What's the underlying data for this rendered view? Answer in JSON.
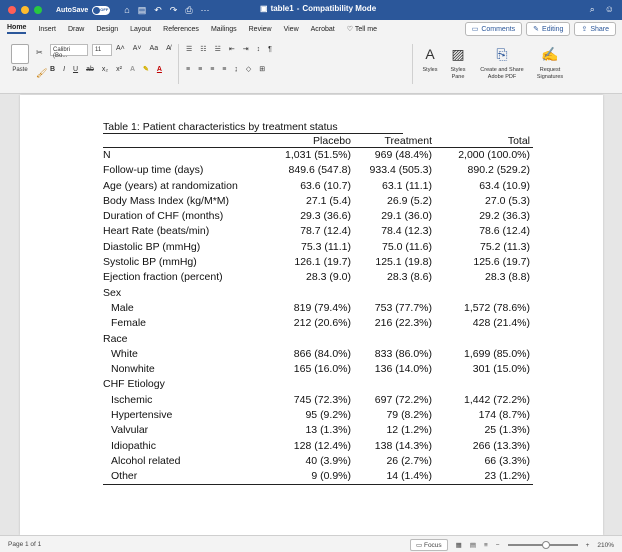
{
  "titlebar": {
    "autosave_label": "AutoSave",
    "autosave_state": "OFF",
    "doc_title": "table1",
    "compat_mode": "Compatibility Mode"
  },
  "tabs": [
    "Home",
    "Insert",
    "Draw",
    "Design",
    "Layout",
    "References",
    "Mailings",
    "Review",
    "View",
    "Acrobat",
    "Tell me"
  ],
  "tab_actions": {
    "comments": "Comments",
    "editing": "Editing",
    "share": "Share"
  },
  "ribbon": {
    "paste_label": "Paste",
    "font_name": "Calibri (Bo...",
    "font_size": "11",
    "styles_label": "Styles",
    "styles_pane_label": "Styles Pane",
    "create_pdf_label": "Create and Share Adobe PDF",
    "request_sig_label": "Request Signatures"
  },
  "table": {
    "caption": "Table 1: Patient characteristics by treatment status",
    "columns": [
      "",
      "Placebo",
      "Treatment",
      "Total"
    ],
    "rows": [
      {
        "label": "N",
        "indent": false,
        "placebo": "1,031 (51.5%)",
        "treatment": "969 (48.4%)",
        "total": "2,000 (100.0%)"
      },
      {
        "label": "Follow-up time (days)",
        "indent": false,
        "placebo": "849.6 (547.8)",
        "treatment": "933.4 (505.3)",
        "total": "890.2 (529.2)"
      },
      {
        "label": "Age (years) at randomization",
        "indent": false,
        "placebo": "63.6 (10.7)",
        "treatment": "63.1 (11.1)",
        "total": "63.4 (10.9)"
      },
      {
        "label": "Body Mass Index (kg/M*M)",
        "indent": false,
        "placebo": "27.1 (5.4)",
        "treatment": "26.9 (5.2)",
        "total": "27.0 (5.3)"
      },
      {
        "label": "Duration of CHF (months)",
        "indent": false,
        "placebo": "29.3 (36.6)",
        "treatment": "29.1 (36.0)",
        "total": "29.2 (36.3)"
      },
      {
        "label": "Heart Rate (beats/min)",
        "indent": false,
        "placebo": "78.7 (12.4)",
        "treatment": "78.4 (12.3)",
        "total": "78.6 (12.4)"
      },
      {
        "label": "Diastolic BP (mmHg)",
        "indent": false,
        "placebo": "75.3 (11.1)",
        "treatment": "75.0 (11.6)",
        "total": "75.2 (11.3)"
      },
      {
        "label": "Systolic BP (mmHg)",
        "indent": false,
        "placebo": "126.1 (19.7)",
        "treatment": "125.1 (19.8)",
        "total": "125.6 (19.7)"
      },
      {
        "label": "Ejection fraction (percent)",
        "indent": false,
        "placebo": "28.3 (9.0)",
        "treatment": "28.3 (8.6)",
        "total": "28.3 (8.8)"
      },
      {
        "label": "Sex",
        "indent": false,
        "placebo": "",
        "treatment": "",
        "total": ""
      },
      {
        "label": "Male",
        "indent": true,
        "placebo": "819 (79.4%)",
        "treatment": "753 (77.7%)",
        "total": "1,572 (78.6%)"
      },
      {
        "label": "Female",
        "indent": true,
        "placebo": "212 (20.6%)",
        "treatment": "216 (22.3%)",
        "total": "428 (21.4%)"
      },
      {
        "label": "Race",
        "indent": false,
        "placebo": "",
        "treatment": "",
        "total": ""
      },
      {
        "label": "White",
        "indent": true,
        "placebo": "866 (84.0%)",
        "treatment": "833 (86.0%)",
        "total": "1,699 (85.0%)"
      },
      {
        "label": "Nonwhite",
        "indent": true,
        "placebo": "165 (16.0%)",
        "treatment": "136 (14.0%)",
        "total": "301 (15.0%)"
      },
      {
        "label": "CHF Etiology",
        "indent": false,
        "placebo": "",
        "treatment": "",
        "total": ""
      },
      {
        "label": "Ischemic",
        "indent": true,
        "placebo": "745 (72.3%)",
        "treatment": "697 (72.2%)",
        "total": "1,442 (72.2%)"
      },
      {
        "label": "Hypertensive",
        "indent": true,
        "placebo": "95 (9.2%)",
        "treatment": "79 (8.2%)",
        "total": "174 (8.7%)"
      },
      {
        "label": "Valvular",
        "indent": true,
        "placebo": "13 (1.3%)",
        "treatment": "12 (1.2%)",
        "total": "25 (1.3%)"
      },
      {
        "label": "Idiopathic",
        "indent": true,
        "placebo": "128 (12.4%)",
        "treatment": "138 (14.3%)",
        "total": "266 (13.3%)"
      },
      {
        "label": "Alcohol related",
        "indent": true,
        "placebo": "40 (3.9%)",
        "treatment": "26 (2.7%)",
        "total": "66 (3.3%)"
      },
      {
        "label": "Other",
        "indent": true,
        "placebo": "9 (0.9%)",
        "treatment": "14 (1.4%)",
        "total": "23 (1.2%)"
      }
    ]
  },
  "statusbar": {
    "page_info": "Page 1 of 1",
    "focus_label": "Focus",
    "zoom": "210%"
  },
  "colors": {
    "titlebar": "#2b579a",
    "close": "#ff5f57",
    "minimize": "#febc2e",
    "zoom": "#28c840"
  }
}
